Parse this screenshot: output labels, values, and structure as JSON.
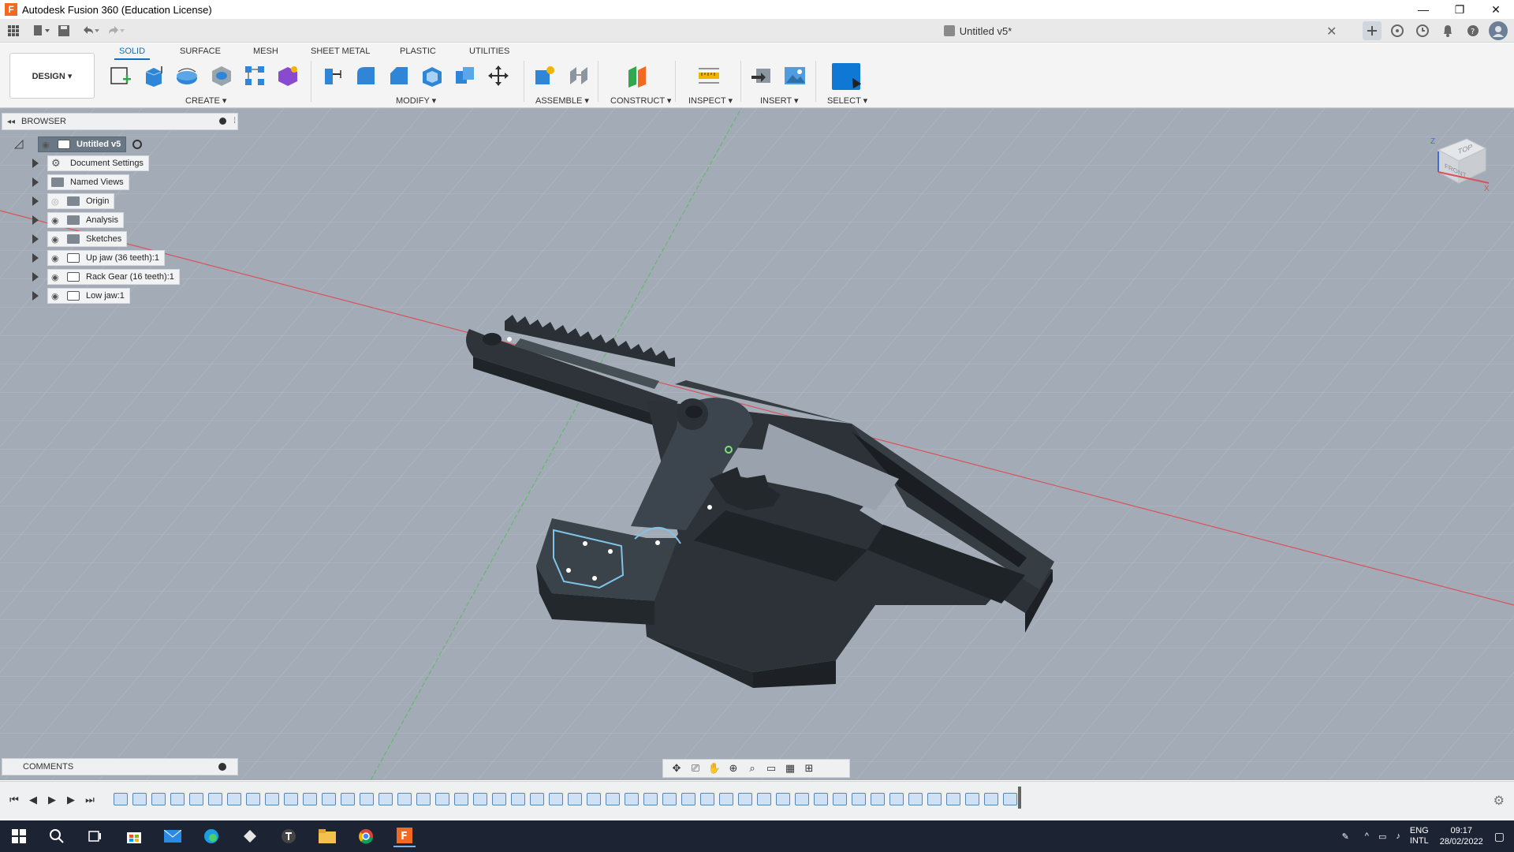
{
  "window": {
    "title": "Autodesk Fusion 360 (Education License)",
    "app_icon": "F",
    "minimize": "—",
    "restore": "❐",
    "close": "✕"
  },
  "document": {
    "tab_title": "Untitled v5*",
    "close_glyph": "✕"
  },
  "ribbon": {
    "workspace": "DESIGN ▾",
    "tabs": [
      "SOLID",
      "SURFACE",
      "MESH",
      "SHEET METAL",
      "PLASTIC",
      "UTILITIES"
    ],
    "groups": {
      "create": "CREATE ▾",
      "modify": "MODIFY ▾",
      "assemble": "ASSEMBLE ▾",
      "construct": "CONSTRUCT ▾",
      "inspect": "INSPECT ▾",
      "insert": "INSERT ▾",
      "select": "SELECT ▾"
    }
  },
  "browser": {
    "header": "BROWSER",
    "collapse": "◂◂",
    "grip": "⁞",
    "root": "Untitled v5",
    "items": [
      {
        "label": "Document Settings",
        "icon": "gear-icon",
        "eye": ""
      },
      {
        "label": "Named Views",
        "icon": "folder-icon",
        "eye": ""
      },
      {
        "label": "Origin",
        "icon": "folder-icon",
        "eye": "◎"
      },
      {
        "label": "Analysis",
        "icon": "folder-icon",
        "eye": "◉"
      },
      {
        "label": "Sketches",
        "icon": "folder-icon",
        "eye": "◉"
      },
      {
        "label": "Up jaw (36 teeth):1",
        "icon": "component-icon",
        "eye": "◉"
      },
      {
        "label": "Rack Gear (16 teeth):1",
        "icon": "component-icon",
        "eye": "◉"
      },
      {
        "label": "Low jaw:1",
        "icon": "component-icon",
        "eye": "◉"
      }
    ]
  },
  "viewcube": {
    "top": "TOP",
    "front": "FRONT",
    "axis_z": "Z",
    "axis_x": "X"
  },
  "comments": {
    "label": "COMMENTS"
  },
  "taskbar": {
    "language": "ENG",
    "layout": "INTL",
    "time": "09:17",
    "date": "28/02/2022"
  },
  "colors": {
    "viewport_bg": "#a3acb6",
    "accent_blue": "#0f78d4",
    "model_body": "#3a4148",
    "sketch_line": "#7fc3e6"
  }
}
